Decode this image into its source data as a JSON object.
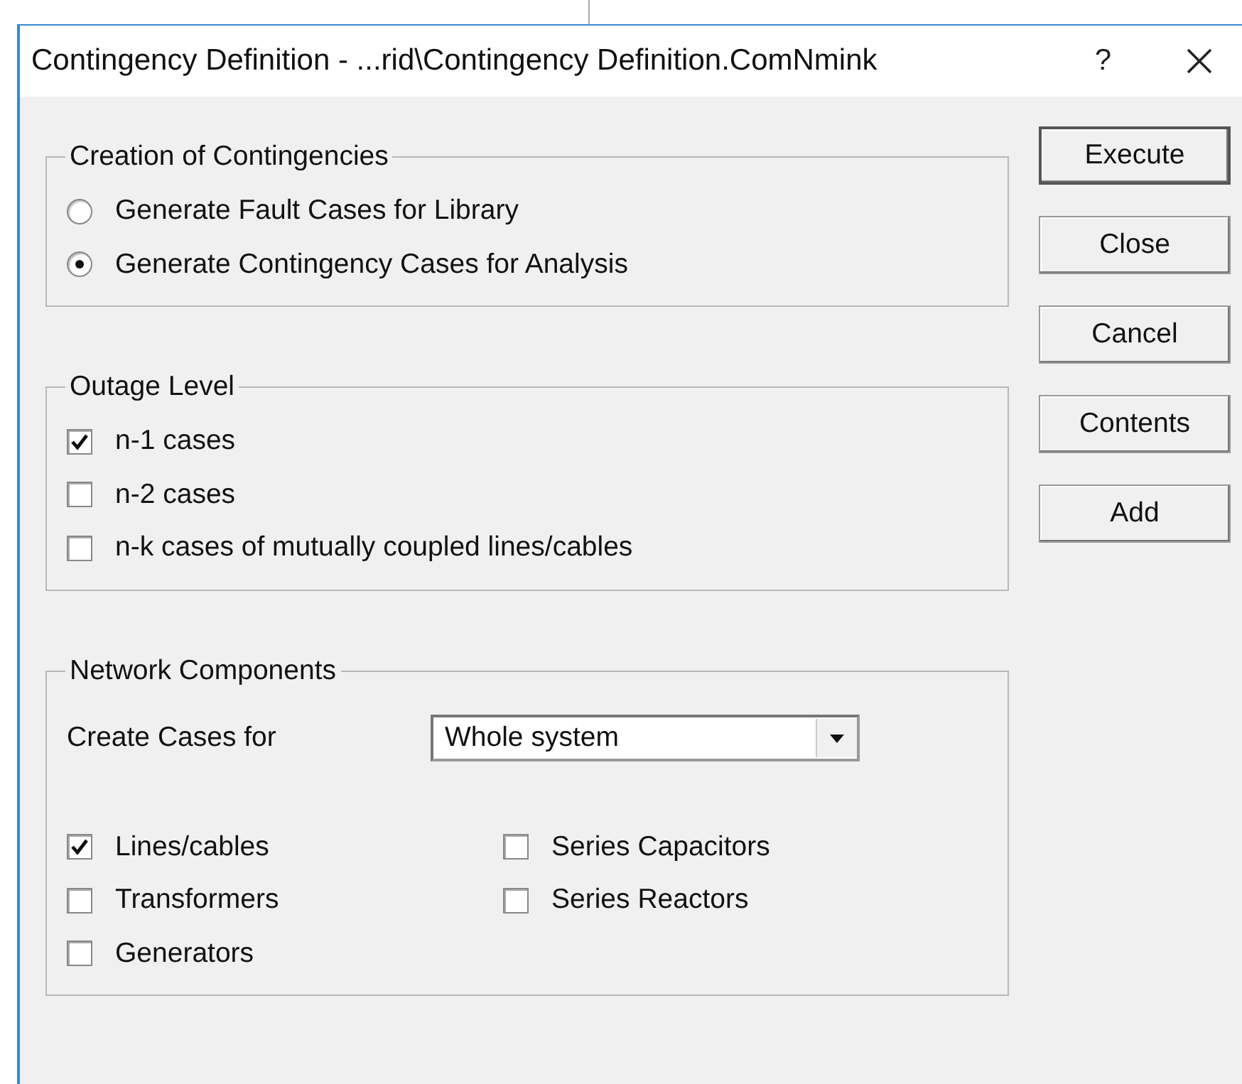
{
  "window": {
    "title": "Contingency Definition - ...rid\\Contingency Definition.ComNmink",
    "help": "?"
  },
  "groups": [
    {
      "title": "Creation of Contingencies",
      "items": [
        {
          "kind": "radio",
          "label": "Generate Fault Cases for Library",
          "selected": false
        },
        {
          "kind": "radio",
          "label": "Generate Contingency Cases for Analysis",
          "selected": true
        }
      ]
    },
    {
      "title": "Outage Level",
      "items": [
        {
          "kind": "checkbox",
          "label": "n-1 cases",
          "checked": true
        },
        {
          "kind": "checkbox",
          "label": "n-2 cases",
          "checked": false
        },
        {
          "kind": "checkbox",
          "label": "n-k cases of mutually coupled lines/cables",
          "checked": false
        }
      ]
    },
    {
      "title": "Network Components",
      "dropdown": {
        "label": "Create Cases for",
        "value": "Whole system"
      },
      "columns": [
        [
          {
            "kind": "checkbox",
            "label": "Lines/cables",
            "checked": true
          },
          {
            "kind": "checkbox",
            "label": "Transformers",
            "checked": false
          },
          {
            "kind": "checkbox",
            "label": "Generators",
            "checked": false
          }
        ],
        [
          {
            "kind": "checkbox",
            "label": "Series Capacitors",
            "checked": false
          },
          {
            "kind": "checkbox",
            "label": "Series Reactors",
            "checked": false
          }
        ]
      ]
    }
  ],
  "buttons": [
    {
      "label": "Execute",
      "default": true
    },
    {
      "label": "Close",
      "default": false
    },
    {
      "label": "Cancel",
      "default": false
    },
    {
      "label": "Contents",
      "default": false
    },
    {
      "label": "Add",
      "default": false
    }
  ]
}
